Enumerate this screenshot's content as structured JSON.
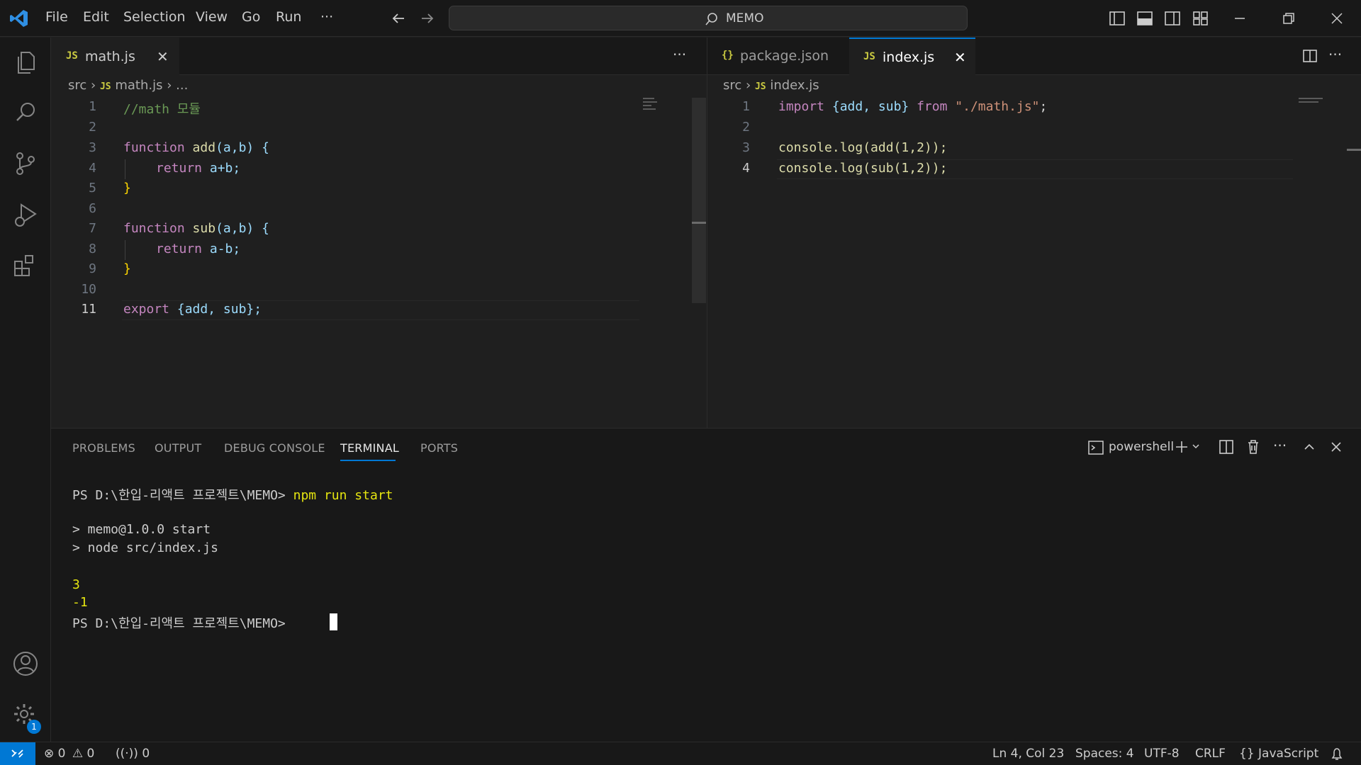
{
  "menu": [
    "File",
    "Edit",
    "Selection",
    "View",
    "Go",
    "Run",
    "···"
  ],
  "search": {
    "text": "MEMO"
  },
  "left_editor": {
    "tab": {
      "icon": "JS",
      "label": "math.js"
    },
    "breadcrumb": [
      "src",
      "JS",
      "math.js",
      "..."
    ],
    "more": "···",
    "lines": [
      {
        "n": "1"
      },
      {
        "n": "2"
      },
      {
        "n": "3"
      },
      {
        "n": "4"
      },
      {
        "n": "5"
      },
      {
        "n": "6"
      },
      {
        "n": "7"
      },
      {
        "n": "8"
      },
      {
        "n": "9"
      },
      {
        "n": "10"
      },
      {
        "n": "11"
      }
    ],
    "code": {
      "l1": "//math 모듈",
      "l3_kw": "function",
      "l3_fn": "add",
      "l3_rest": "(a,b) {",
      "l4_kw": "return",
      "l4_rest": " a+b;",
      "l5": "}",
      "l7_kw": "function",
      "l7_fn": "sub",
      "l7_rest": "(a,b) {",
      "l8_kw": "return",
      "l8_rest": " a-b;",
      "l9": "}",
      "l11_kw": "export",
      "l11_rest": " {add, sub};"
    }
  },
  "right_editor": {
    "tabs": [
      {
        "icon": "{}",
        "label": "package.json"
      },
      {
        "icon": "JS",
        "label": "index.js"
      }
    ],
    "breadcrumb": [
      "src",
      "JS",
      "index.js"
    ],
    "lines": [
      {
        "n": "1"
      },
      {
        "n": "2"
      },
      {
        "n": "3"
      },
      {
        "n": "4"
      }
    ],
    "code": {
      "l1_kw": "import",
      "l1_mid": " {add, sub} ",
      "l1_from": "from",
      "l1_str": "\"./math.js\"",
      "l1_end": ";",
      "l3": "console.log(add(1,2));",
      "l4": "console.log(sub(1,2));"
    }
  },
  "panel": {
    "tabs": [
      "PROBLEMS",
      "OUTPUT",
      "DEBUG CONSOLE",
      "TERMINAL",
      "PORTS"
    ],
    "active_tab": "TERMINAL",
    "shell": "powershell",
    "terminal": {
      "prompt1": "PS D:\\한입-리액트 프로젝트\\MEMO>",
      "cmd1": "npm run start",
      "out1": "> memo@1.0.0 start",
      "out2": "> node src/index.js",
      "res1": "3",
      "res2": "-1",
      "prompt2": "PS D:\\한입-리액트 프로젝트\\MEMO>"
    }
  },
  "status": {
    "errors": "0",
    "warnings": "0",
    "ports": "0",
    "position": "Ln 4, Col 23",
    "spaces": "Spaces: 4",
    "encoding": "UTF-8",
    "eol": "CRLF",
    "language": "JavaScript",
    "settings_badge": "1"
  },
  "colors": {
    "accent": "#0078d4",
    "js_icon": "#cbcb41",
    "keyword": "#c586c0",
    "function": "#dcdcaa",
    "terminal_result": "#e5e510"
  }
}
